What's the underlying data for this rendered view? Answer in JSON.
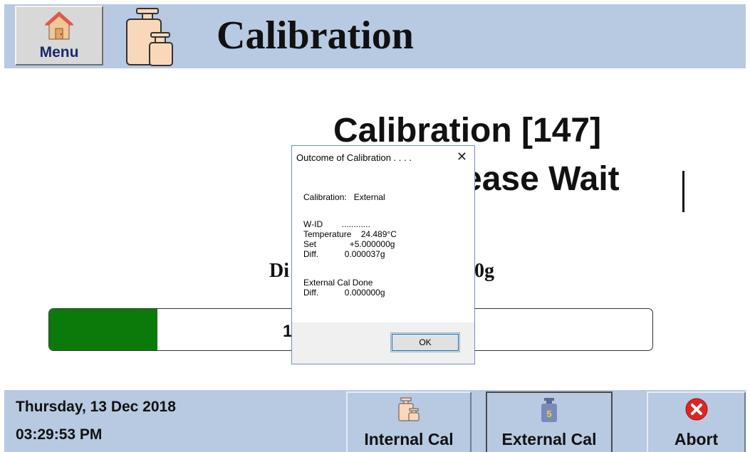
{
  "header": {
    "menu_label": "Menu",
    "title": "Calibration"
  },
  "main": {
    "status_line1": "Calibration [147]",
    "status_line2": "ease Wait",
    "diff_left": "Di",
    "diff_right": "0g",
    "progress_fraction": 0.18,
    "progress_text": "1"
  },
  "dialog": {
    "title": "Outcome of Calibration . . . .",
    "close_glyph": "✕",
    "line_calibration": "Calibration:   External",
    "line_wid": "W-ID        ............",
    "line_temperature": "Temperature    24.489°C",
    "line_set": "Set              +5.000000g",
    "line_diff": "Diff.           0.000037g",
    "line_done": "External Cal Done",
    "line_diff2": "Diff.           0.000000g",
    "ok_label": "OK"
  },
  "footer": {
    "date": "Thursday, 13 Dec 2018",
    "time": "03:29:53 PM",
    "internal_label": "Internal Cal",
    "external_label": "External Cal",
    "external_weight_number": "5",
    "abort_label": "Abort"
  },
  "colors": {
    "bar_background": "#b8c9e2",
    "progress_green": "#0b7a0b",
    "abort_red": "#e02424"
  }
}
